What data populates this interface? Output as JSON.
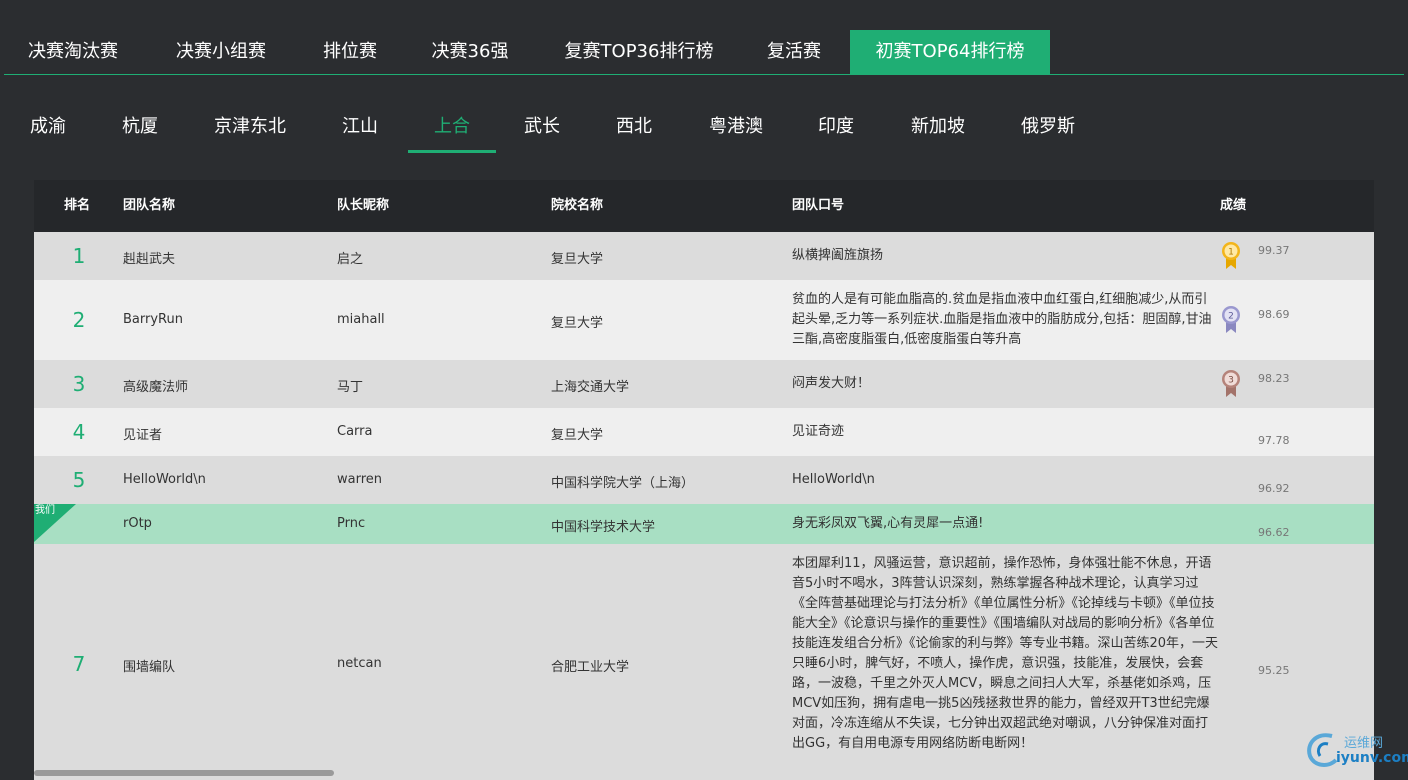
{
  "top_tabs": [
    {
      "label": "决赛淘汰赛"
    },
    {
      "label": "决赛小组赛"
    },
    {
      "label": "排位赛"
    },
    {
      "label": "决赛36强"
    },
    {
      "label": "复赛TOP36排行榜"
    },
    {
      "label": "复活赛"
    },
    {
      "label": "初赛TOP64排行榜"
    }
  ],
  "region_tabs": [
    {
      "label": "成渝"
    },
    {
      "label": "杭厦"
    },
    {
      "label": "京津东北"
    },
    {
      "label": "江山"
    },
    {
      "label": "上合"
    },
    {
      "label": "武长"
    },
    {
      "label": "西北"
    },
    {
      "label": "粤港澳"
    },
    {
      "label": "印度"
    },
    {
      "label": "新加坡"
    },
    {
      "label": "俄罗斯"
    }
  ],
  "table": {
    "headers": {
      "rank": "排名",
      "team": "团队名称",
      "captain": "队长昵称",
      "school": "院校名称",
      "slogan": "团队口号",
      "score": "成绩"
    },
    "mine_flag": "我们",
    "rows": [
      {
        "rank": "1",
        "team": "赳赳武夫",
        "captain": "启之",
        "school": "复旦大学",
        "slogan": "纵横捭阖旌旗扬",
        "score": "99.37",
        "medal": "1"
      },
      {
        "rank": "2",
        "team": "BarryRun",
        "captain": "miahall",
        "school": "复旦大学",
        "slogan": "贫血的人是有可能血脂高的.贫血是指血液中血红蛋白,红细胞减少,从而引起头晕,乏力等一系列症状.血脂是指血液中的脂肪成分,包括：胆固醇,甘油三酯,高密度脂蛋白,低密度脂蛋白等升高",
        "score": "98.69",
        "medal": "2"
      },
      {
        "rank": "3",
        "team": "高级魔法师",
        "captain": "马丁",
        "school": "上海交通大学",
        "slogan": "闷声发大财！",
        "score": "98.23",
        "medal": "3"
      },
      {
        "rank": "4",
        "team": "见证者",
        "captain": "Carra",
        "school": "复旦大学",
        "slogan": "见证奇迹",
        "score": "97.78",
        "medal": ""
      },
      {
        "rank": "5",
        "team": "HelloWorld\\n",
        "captain": "warren",
        "school": "中国科学院大学（上海）",
        "slogan": "HelloWorld\\n",
        "score": "96.92",
        "medal": ""
      },
      {
        "rank": "",
        "team": "rOtp",
        "captain": "Prnc",
        "school": "中国科学技术大学",
        "slogan": "身无彩凤双飞翼,心有灵犀一点通!",
        "score": "96.62",
        "medal": ""
      },
      {
        "rank": "7",
        "team": "围墙编队",
        "captain": "netcan",
        "school": "合肥工业大学",
        "slogan": "本团犀利11，风骚运营，意识超前，操作恐怖，身体强壮能不休息，开语音5小时不喝水，3阵营认识深刻，熟练掌握各种战术理论，认真学习过《全阵营基础理论与打法分析》《单位属性分析》《论掉线与卡顿》《单位技能大全》《论意识与操作的重要性》《围墙编队对战局的影响分析》《各单位技能连发组合分析》《论偷家的利与弊》等专业书籍。深山苦练20年，一天只睡6小时，脾气好，不喷人，操作虎，意识强，技能准，发展快，会套路，一波稳，千里之外灭人MCV，瞬息之间扫人大军，杀基佬如杀鸡，压MCV如压狗，拥有虐电一挑5凶残拯救世界的能力，曾经双开T3世纪完爆对面，冷冻连缩从不失误，七分钟出双超武绝对嘲讽，八分钟保准对面打出GG，有自用电源专用网络防断电断网！",
        "score": "95.25",
        "medal": ""
      }
    ]
  },
  "watermark": {
    "line1": "运维网",
    "line2": "iyunv.com"
  },
  "colors": {
    "accent": "#1fae74",
    "background": "#2b2d30",
    "header": "#25272a"
  }
}
